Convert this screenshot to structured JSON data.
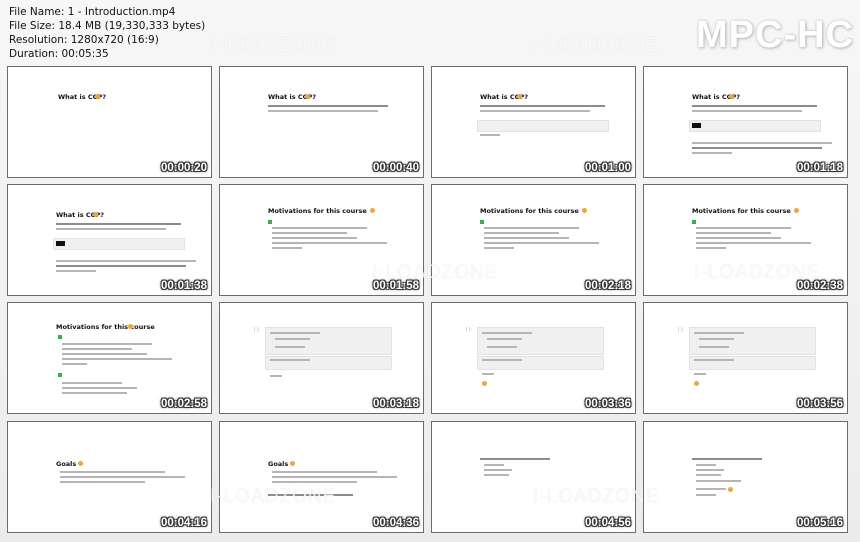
{
  "file_info": {
    "name": "File Name: 1 - Introduction.mp4",
    "size": "File Size: 18.4 MB (19,330,333 bytes)",
    "resolution": "Resolution: 1280x720 (16:9)",
    "duration": "Duration: 00:05:35"
  },
  "brand": "MPC-HC",
  "watermark": "I-LOADZONE",
  "thumbnails": [
    {
      "time": "00:00:20",
      "title": "What is CCP?"
    },
    {
      "time": "00:00:40",
      "title": "What is CCP?"
    },
    {
      "time": "00:01:00",
      "title": "What is CCP?"
    },
    {
      "time": "00:01:18",
      "title": "What is CCP?"
    },
    {
      "time": "00:01:38",
      "title": "What is CCP?"
    },
    {
      "time": "00:01:58",
      "title": "Motivations for this course"
    },
    {
      "time": "00:02:18",
      "title": "Motivations for this course"
    },
    {
      "time": "00:02:38",
      "title": "Motivations for this course"
    },
    {
      "time": "00:02:58",
      "title": "Motivations for this course"
    },
    {
      "time": "00:03:18",
      "title": ""
    },
    {
      "time": "00:03:36",
      "title": ""
    },
    {
      "time": "00:03:56",
      "title": ""
    },
    {
      "time": "00:04:16",
      "title": "Goals"
    },
    {
      "time": "00:04:36",
      "title": "Goals"
    },
    {
      "time": "00:04:56",
      "title": ""
    },
    {
      "time": "00:05:16",
      "title": ""
    }
  ]
}
